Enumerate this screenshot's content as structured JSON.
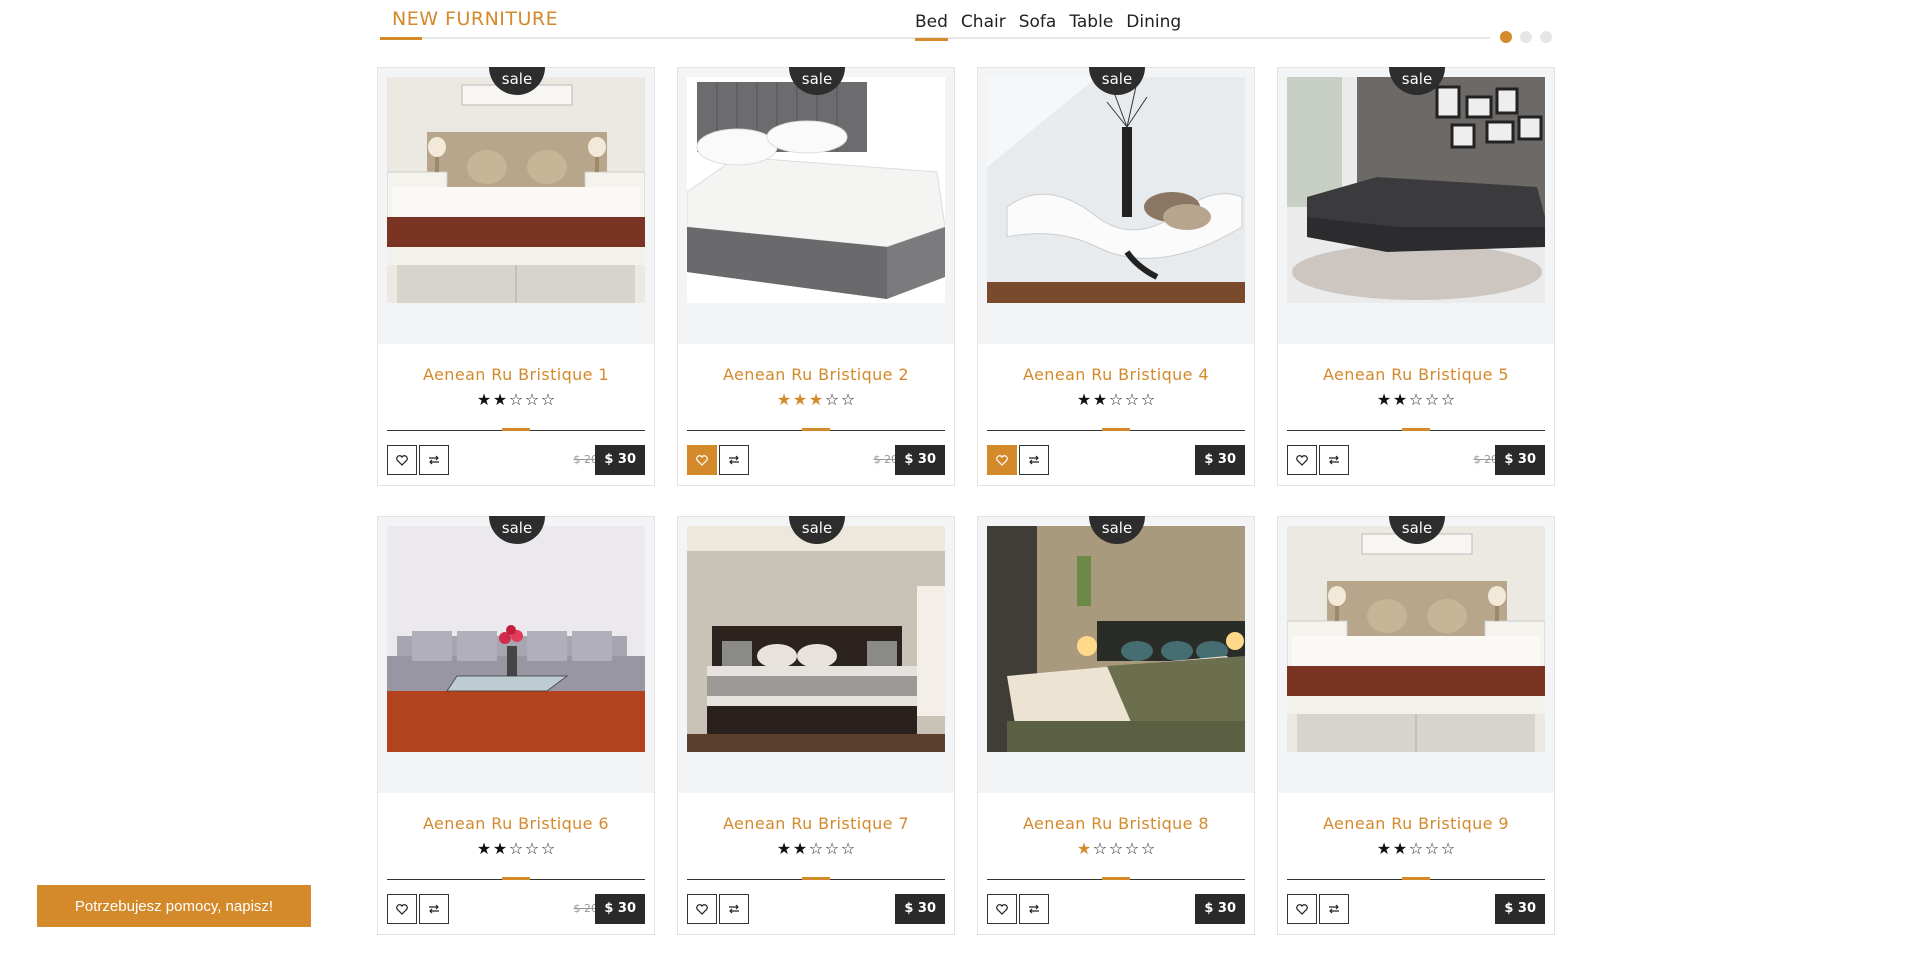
{
  "section": {
    "title": "NEW FURNITURE"
  },
  "tabs": [
    "Bed",
    "Chair",
    "Sofa",
    "Table",
    "Dining"
  ],
  "active_tab": 0,
  "slider_dots": 3,
  "active_dot": 0,
  "products": [
    {
      "name": "Aenean Ru Bristique 1",
      "badge": "sale",
      "rating": 2,
      "gold": false,
      "old_price": "$ 20",
      "price": "$ 30",
      "wish_active": false,
      "scene": "bedroom"
    },
    {
      "name": "Aenean Ru Bristique 2",
      "badge": "sale",
      "rating": 3,
      "gold": true,
      "old_price": "$ 20",
      "price": "$ 30",
      "wish_active": true,
      "scene": "greybed"
    },
    {
      "name": "Aenean Ru Bristique 4",
      "badge": "sale",
      "rating": 2,
      "gold": false,
      "old_price": "",
      "price": "$ 30",
      "wish_active": true,
      "scene": "lounge"
    },
    {
      "name": "Aenean Ru Bristique 5",
      "badge": "sale",
      "rating": 2,
      "gold": false,
      "old_price": "$ 20",
      "price": "$ 30",
      "wish_active": false,
      "scene": "sectional"
    },
    {
      "name": "Aenean Ru Bristique 6",
      "badge": "sale",
      "rating": 2,
      "gold": false,
      "old_price": "$ 20",
      "price": "$ 30",
      "wish_active": false,
      "scene": "sofa"
    },
    {
      "name": "Aenean Ru Bristique 7",
      "badge": "sale",
      "rating": 2,
      "gold": false,
      "old_price": "",
      "price": "$ 30",
      "wish_active": false,
      "scene": "darkbed"
    },
    {
      "name": "Aenean Ru Bristique 8",
      "badge": "sale",
      "rating": 1,
      "gold": true,
      "old_price": "",
      "price": "$ 30",
      "wish_active": false,
      "scene": "hotel"
    },
    {
      "name": "Aenean Ru Bristique 9",
      "badge": "sale",
      "rating": 2,
      "gold": false,
      "old_price": "",
      "price": "$ 30",
      "wish_active": false,
      "scene": "bedroom"
    }
  ],
  "help_button": "Potrzebujesz pomocy, napisz!",
  "colors": {
    "accent": "#d4892b",
    "dark": "#2a2a2a"
  }
}
